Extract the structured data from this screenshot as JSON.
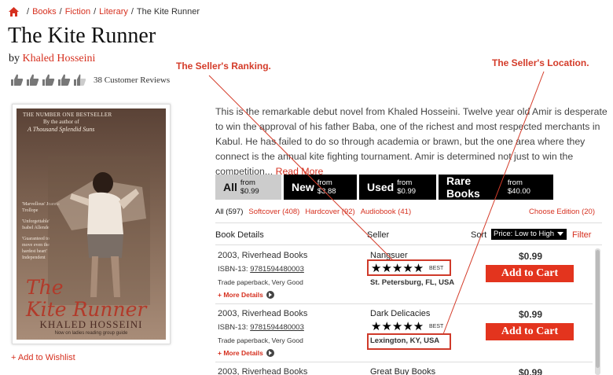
{
  "breadcrumb": {
    "home_icon": "home-icon",
    "items": [
      "Books",
      "Fiction",
      "Literary"
    ],
    "current": "The Kite Runner",
    "separator": "/"
  },
  "book": {
    "title": "The Kite Runner",
    "by_label": "by",
    "author": "Khaled Hosseini",
    "rating_icon": "thumbs-up-icon",
    "rating_count": 4.5,
    "reviews_text": "38 Customer Reviews"
  },
  "cover": {
    "tag_line_1": "THE NUMBER ONE BESTSELLER",
    "tag_line_2": "By the author of",
    "tag_line_3": "A Thousand Splendid Suns",
    "quote_1": "'Marvellous' Joanna Trollope",
    "quote_2": "'Unforgettable' Isabel Allende",
    "quote_3": "'Guaranteed to move even the hardest heart' Independent",
    "script_title_1": "The",
    "script_title_2": "Kite Runner",
    "author": "KHALED HOSSEINI",
    "note": "Now on ladies reading group guide"
  },
  "wishlist": "+ Add to Wishlist",
  "description": {
    "text": "This is the remarkable debut novel from Khaled Hosseini. Twelve year old Amir is desperate to win the approval of his father Baba, one of the richest and most respected merchants in Kabul. He has failed to do so through academia or brawn, but the one area where they connect is the annual kite fighting tournament. Amir is determined not just to win the competition...",
    "more": "Read More"
  },
  "tabs": [
    {
      "label": "All",
      "sub": "from $0.99",
      "active": true
    },
    {
      "label": "New",
      "sub": "from $3.88",
      "active": false
    },
    {
      "label": "Used",
      "sub": "from $0.99",
      "active": false
    },
    {
      "label": "Rare Books",
      "sub": "from $40.00",
      "active": false
    }
  ],
  "formats": {
    "all": "All (597)",
    "softcover": "Softcover (408)",
    "hardcover": "Hardcover (92)",
    "audiobook": "Audiobook (41)",
    "edition": "Choose Edition (20)"
  },
  "columns": {
    "details": "Book Details",
    "seller": "Seller",
    "sort": "Sort",
    "sort_value": "Price: Low to High",
    "filter": "Filter"
  },
  "listings": [
    {
      "publisher": "2003, Riverhead Books",
      "isbn_label": "ISBN-13:",
      "isbn": "9781594480003",
      "condition": "Trade paperback, Very Good",
      "more": "+ More Details",
      "seller": "Nangsuer",
      "stars": "★★★★★",
      "rating": 5,
      "badge": "BEST",
      "location": "St. Petersburg, FL, USA",
      "price": "$0.99",
      "cart": "Add to Cart"
    },
    {
      "publisher": "2003, Riverhead Books",
      "isbn_label": "ISBN-13:",
      "isbn": "9781594480003",
      "condition": "Trade paperback, Very Good",
      "more": "+ More Details",
      "seller": "Dark Delicacies",
      "stars": "★★★★★",
      "rating": 5,
      "badge": "BEST",
      "location": "Lexington, KY, USA",
      "price": "$0.99",
      "cart": "Add to Cart"
    },
    {
      "publisher": "2003, Riverhead Books",
      "seller": "Great Buy Books",
      "price": "$0.99"
    }
  ],
  "annotations": {
    "ranking": "The Seller's Ranking.",
    "location": "The Seller's Location."
  },
  "colors": {
    "accent": "#d6301f",
    "annotation": "#d43c2a",
    "tab_dark": "#000000",
    "tab_active": "#cccccc"
  }
}
